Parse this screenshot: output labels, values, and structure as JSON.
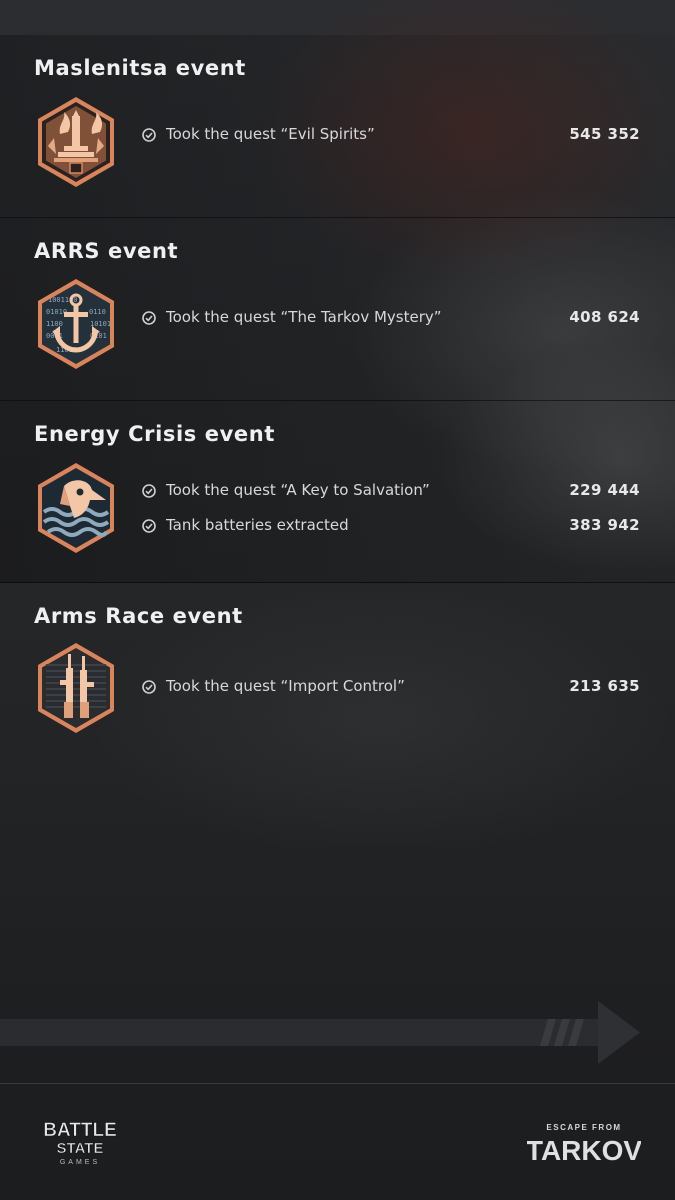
{
  "sections": [
    {
      "title": "Maslenitsa event",
      "badge_icon": "maslenitsa-badge-icon",
      "rows": [
        {
          "label": "Took the quest “Evil Spirits”",
          "value": "545 352"
        }
      ]
    },
    {
      "title": "ARRS event",
      "badge_icon": "anchor-badge-icon",
      "badge_binary": [
        "1001100",
        "01010",
        "1100",
        "0001",
        "0101",
        "0110",
        "11000",
        "10101",
        "1100"
      ],
      "rows": [
        {
          "label": "Took the quest “The Tarkov Mystery”",
          "value": "408 624"
        }
      ]
    },
    {
      "title": "Energy Crisis event",
      "badge_icon": "plague-doctor-badge-icon",
      "rows": [
        {
          "label": "Took the quest “A Key to Salvation”",
          "value": "229 444"
        },
        {
          "label": "Tank batteries extracted",
          "value": "383 942"
        }
      ]
    },
    {
      "title": "Arms Race event",
      "badge_icon": "rifles-badge-icon",
      "rows": [
        {
          "label": "Took the quest “Import Control”",
          "value": "213 635"
        }
      ]
    }
  ],
  "footer": {
    "left_logo": {
      "line1": "BATTLE",
      "line2": "STATE",
      "line3": "GAMES"
    },
    "right_logo": {
      "top": "ESCAPE FROM",
      "main": "TARKOV"
    }
  },
  "colors": {
    "badge_copper": "#d9855c",
    "badge_light": "#f3c7a6",
    "badge_dark": "#2a2220",
    "badge_blue": "#8fa9bd"
  }
}
